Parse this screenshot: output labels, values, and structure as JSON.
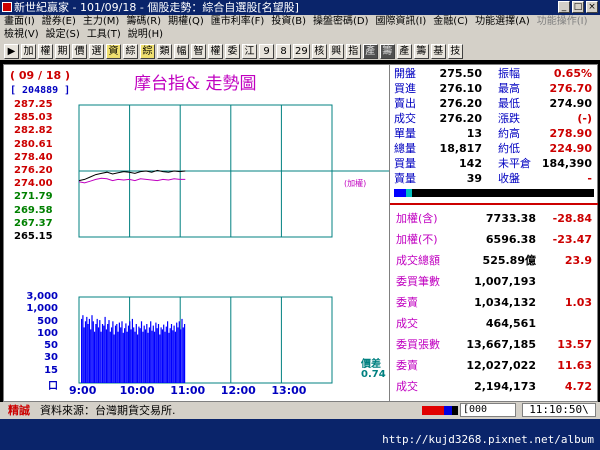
{
  "window": {
    "title": "新世紀贏家 - 101/09/18 - 個股走勢：綜合自選股[名望股]"
  },
  "menu": {
    "row1": [
      {
        "label": "畫面(Ⅰ)",
        "enabled": true
      },
      {
        "label": "證券(E)",
        "enabled": true
      },
      {
        "label": "主力(M)",
        "enabled": true
      },
      {
        "label": "籌碼(R)",
        "enabled": true
      },
      {
        "label": "期權(Q)",
        "enabled": true
      },
      {
        "label": "匯市利率(F)",
        "enabled": true
      },
      {
        "label": "投資(B)",
        "enabled": true
      },
      {
        "label": "操盤密碼(D)",
        "enabled": true
      },
      {
        "label": "國際資訊(I)",
        "enabled": true
      },
      {
        "label": "金融(C)",
        "enabled": true
      },
      {
        "label": "功能選擇(A)",
        "enabled": true
      },
      {
        "label": "功能操作(I)",
        "enabled": false
      }
    ],
    "row2": [
      {
        "label": "檢視(V)",
        "enabled": true
      },
      {
        "label": "設定(S)",
        "enabled": true
      },
      {
        "label": "工具(T)",
        "enabled": true
      },
      {
        "label": "說明(H)",
        "enabled": true
      }
    ]
  },
  "toolbar": {
    "buttons": [
      {
        "label": "▶",
        "style": "normal"
      },
      {
        "label": "加",
        "style": "normal"
      },
      {
        "label": "權",
        "style": "normal"
      },
      {
        "label": "期",
        "style": "normal"
      },
      {
        "label": "價",
        "style": "normal"
      },
      {
        "label": "選",
        "style": "normal"
      },
      {
        "label": "資",
        "style": "hl"
      },
      {
        "label": "綜",
        "style": "normal"
      },
      {
        "label": "綜",
        "style": "hl"
      },
      {
        "label": "類",
        "style": "normal"
      },
      {
        "label": "幅",
        "style": "normal"
      },
      {
        "label": "智",
        "style": "normal"
      },
      {
        "label": "權",
        "style": "normal"
      },
      {
        "label": "委",
        "style": "normal"
      },
      {
        "label": "江",
        "style": "normal"
      },
      {
        "label": "9",
        "style": "normal"
      },
      {
        "label": "8",
        "style": "normal"
      },
      {
        "label": "29",
        "style": "normal"
      },
      {
        "label": "核",
        "style": "normal"
      },
      {
        "label": "興",
        "style": "normal"
      },
      {
        "label": "指",
        "style": "normal"
      },
      {
        "label": "產",
        "style": "dark"
      },
      {
        "label": "籌",
        "style": "dark"
      },
      {
        "label": "產",
        "style": "normal"
      },
      {
        "label": "籌",
        "style": "normal"
      },
      {
        "label": "基",
        "style": "normal"
      },
      {
        "label": "技",
        "style": "normal"
      }
    ]
  },
  "chart": {
    "date": "( 09 / 18 )",
    "title": "摩台指&  走勢圖",
    "code": "[ 204889 ]",
    "side_note": "(加權)",
    "vol_note_label": "價差",
    "vol_note_value": "0.74"
  },
  "chart_data": {
    "type": "line",
    "x_ticks": [
      "9:00",
      "10:00",
      "11:00",
      "12:00",
      "13:00"
    ],
    "y_ticks": [
      "287.25",
      "285.03",
      "282.82",
      "280.61",
      "278.40",
      "276.20",
      "274.00",
      "271.79",
      "269.58",
      "267.37",
      "265.15"
    ],
    "ylim": [
      265.15,
      287.25
    ],
    "reference": 276.2,
    "volume_ticks": [
      "3,000",
      "1,000",
      "500",
      "100",
      "50",
      "30",
      "15",
      "口"
    ],
    "series": [
      {
        "values": [
          274.6,
          274.8,
          275.2,
          275.6,
          275.8,
          276.0,
          275.7,
          275.9,
          276.1,
          276.0,
          275.8,
          276.1,
          276.2,
          276.0,
          276.3,
          276.1,
          276.0,
          276.2,
          276.1,
          276.2
        ],
        "color": "#000000"
      },
      {
        "values": [
          274.4,
          274.2,
          274.5,
          274.8,
          275.0,
          274.9,
          274.6,
          274.8,
          274.7,
          274.8,
          274.6,
          274.9,
          274.8,
          274.7,
          274.6,
          274.8,
          274.7,
          274.9,
          274.8,
          274.8
        ],
        "color": "#c000c0"
      }
    ],
    "volume": [
      700,
      900,
      400,
      600,
      800,
      500,
      700,
      350,
      900,
      600,
      300,
      500,
      700,
      400,
      650,
      300,
      500,
      450,
      800,
      350,
      500,
      650,
      300,
      400,
      600,
      250,
      450,
      500,
      300,
      550,
      400,
      600,
      280,
      380,
      520,
      300,
      450,
      600,
      350,
      700,
      400,
      300,
      500,
      250,
      420,
      380,
      600,
      300,
      450,
      350,
      500,
      280,
      400,
      600,
      320,
      450,
      300,
      550,
      380,
      500,
      250,
      400,
      350,
      480,
      300,
      420,
      600,
      280,
      380,
      500,
      330,
      450,
      300,
      550,
      400,
      600,
      350,
      700,
      400,
      500
    ]
  },
  "quote": {
    "rows": [
      {
        "l1": "開盤",
        "v1": "275.50",
        "l2": "振幅",
        "v2": "0.65%",
        "c2": "#c00"
      },
      {
        "l1": "買進",
        "v1": "276.10",
        "l2": "最高",
        "v2": "276.70",
        "c2": "#c00"
      },
      {
        "l1": "賣出",
        "v1": "276.20",
        "l2": "最低",
        "v2": "274.90",
        "c2": "#000"
      },
      {
        "l1": "成交",
        "v1": "276.20",
        "l2": "漲跌",
        "v2": "(-)",
        "c2": "#c00"
      },
      {
        "l1": "單量",
        "v1": "13",
        "l2": "約高",
        "v2": "278.90",
        "c2": "#c00"
      },
      {
        "l1": "總量",
        "v1": "18,817",
        "l2": "約低",
        "v2": "224.90",
        "c2": "#c00"
      },
      {
        "l1": "買量",
        "v1": "142",
        "l2": "未平倉",
        "v2": "184,390",
        "c2": "#000"
      },
      {
        "l1": "賣量",
        "v1": "39",
        "l2": "收盤",
        "v2": "-",
        "c2": "#c00"
      }
    ],
    "stats": [
      {
        "label": "加權(含)",
        "value": "7733.38",
        "change": "-28.84"
      },
      {
        "label": "加權(不)",
        "value": "6596.38",
        "change": "-23.47"
      },
      {
        "label": "成交總額",
        "value": "525.89億",
        "change": "23.9"
      },
      {
        "label": "委買筆數",
        "value": "1,007,193",
        "change": ""
      },
      {
        "label": "委賣",
        "value": "1,034,132",
        "change": "1.03"
      },
      {
        "label": "成交",
        "value": "464,561",
        "change": ""
      },
      {
        "label": "委買張數",
        "value": "13,667,185",
        "change": "13.57"
      },
      {
        "label": "委賣",
        "value": "12,027,022",
        "change": "11.63"
      },
      {
        "label": "成交",
        "value": "2,194,173",
        "change": "4.72"
      }
    ]
  },
  "status": {
    "tag": "精誠",
    "message": "資料來源：台灣期貨交易所.",
    "code_input": "[000",
    "time": "11:10:50\\"
  },
  "taskbar": {
    "url": "http://kujd3268.pixnet.net/album"
  }
}
